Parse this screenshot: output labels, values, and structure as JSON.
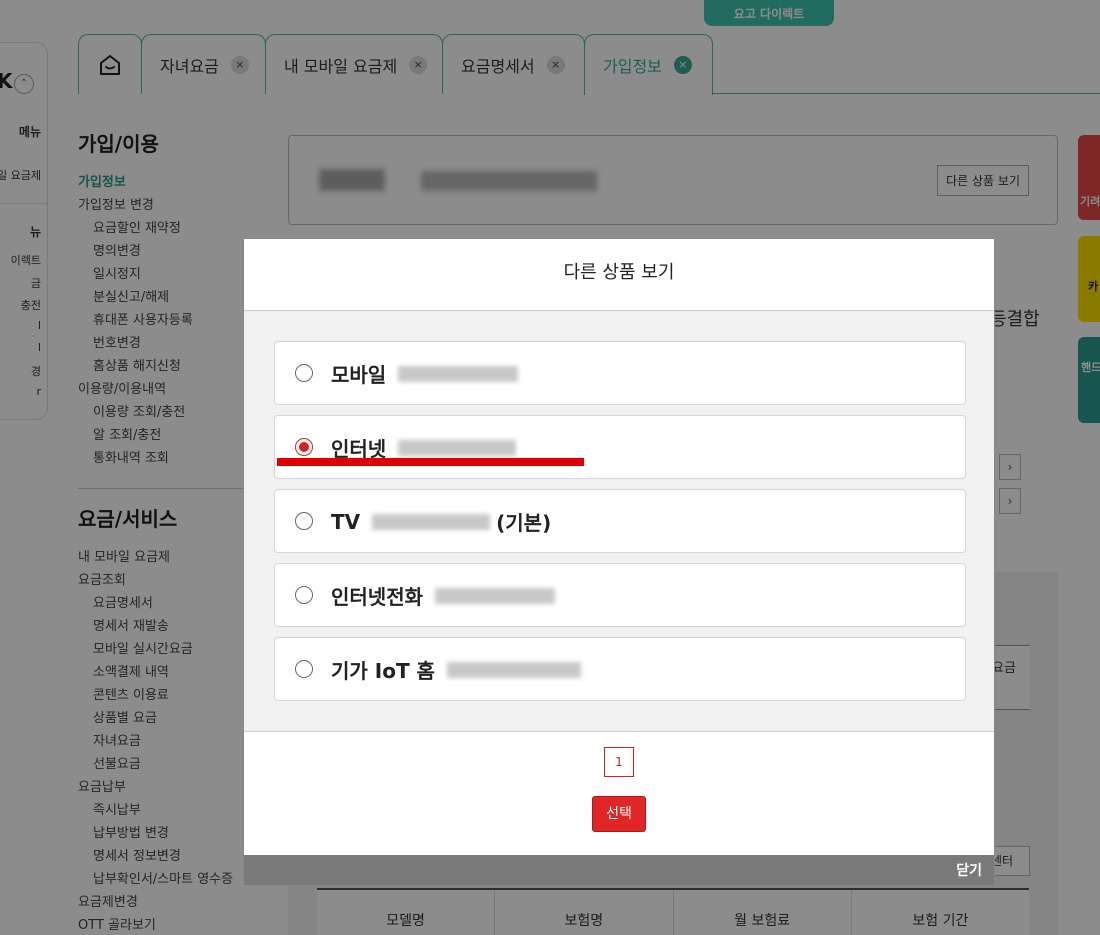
{
  "top_banner": {
    "label": "요고 다이렉트"
  },
  "left_float": {
    "k": "K",
    "items": [
      "메뉴",
      "일 요금제",
      "뉴",
      "이렉트",
      "금",
      "충전",
      "l",
      "l",
      "경",
      "r"
    ]
  },
  "tabs": [
    {
      "label": "자녀요금",
      "close": "×"
    },
    {
      "label": "내 모바일 요금제",
      "close": "×"
    },
    {
      "label": "요금명세서",
      "close": "×"
    },
    {
      "label": "가입정보",
      "close": "×",
      "active": true
    }
  ],
  "sidebar": {
    "section1_title": "가입/이용",
    "section1_items": [
      {
        "label": "가입정보",
        "sub": false,
        "active": true
      },
      {
        "label": "가입정보 변경",
        "sub": false
      },
      {
        "label": "요금할인 재약정",
        "sub": true
      },
      {
        "label": "명의변경",
        "sub": true
      },
      {
        "label": "일시정지",
        "sub": true
      },
      {
        "label": "분실신고/해제",
        "sub": true
      },
      {
        "label": "휴대폰 사용자등록",
        "sub": true
      },
      {
        "label": "번호변경",
        "sub": true
      },
      {
        "label": "홈상품 해지신청",
        "sub": true
      },
      {
        "label": "이용량/이용내역",
        "sub": false
      },
      {
        "label": "이용량 조회/충전",
        "sub": true
      },
      {
        "label": "알 조회/충전",
        "sub": true
      },
      {
        "label": "통화내역 조회",
        "sub": true
      }
    ],
    "section2_title": "요금/서비스",
    "section2_items": [
      {
        "label": "내 모바일 요금제",
        "sub": false
      },
      {
        "label": "요금조회",
        "sub": false
      },
      {
        "label": "요금명세서",
        "sub": true
      },
      {
        "label": "명세서 재발송",
        "sub": true
      },
      {
        "label": "모바일 실시간요금",
        "sub": true
      },
      {
        "label": "소액결제 내역",
        "sub": true
      },
      {
        "label": "콘텐츠 이용료",
        "sub": true
      },
      {
        "label": "상품별 요금",
        "sub": true
      },
      {
        "label": "자녀요금",
        "sub": true
      },
      {
        "label": "선불요금",
        "sub": true
      },
      {
        "label": "요금납부",
        "sub": false
      },
      {
        "label": "즉시납부",
        "sub": true
      },
      {
        "label": "납부방법 변경",
        "sub": true
      },
      {
        "label": "명세서 정보변경",
        "sub": true
      },
      {
        "label": "납부확인서/스마트 영수증",
        "sub": true
      },
      {
        "label": "요금제변경",
        "sub": false
      },
      {
        "label": "OTT 골라보기",
        "sub": false
      }
    ]
  },
  "product_box": {
    "other_button": "다른 상품 보기"
  },
  "background_fragments": {
    "combo": "등결합",
    "chevron": "›",
    "fee": "요금",
    "center": "센터"
  },
  "table_headers": [
    "모델명",
    "보험명",
    "월 보험료",
    "보험 기간"
  ],
  "side_banners": {
    "red": "기려",
    "yellow": "카",
    "teal": "핸드"
  },
  "modal": {
    "title": "다른 상품 보기",
    "options": [
      {
        "label": "모바일",
        "suffix": "",
        "checked": false
      },
      {
        "label": "인터넷",
        "suffix": "",
        "checked": true
      },
      {
        "label": "TV",
        "suffix": "(기본)",
        "checked": false
      },
      {
        "label": "인터넷전화",
        "suffix": "",
        "checked": false
      },
      {
        "label": "기가 IoT 홈",
        "suffix": "",
        "checked": false
      }
    ],
    "page": "1",
    "select_button": "선택",
    "close_button": "닫기"
  }
}
